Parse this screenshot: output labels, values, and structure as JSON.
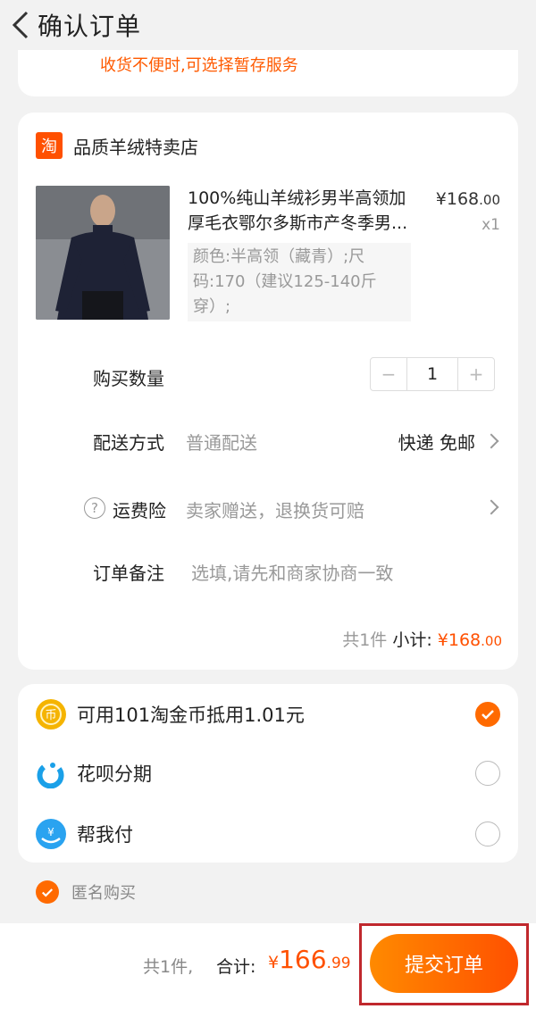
{
  "header": {
    "title": "确认订单",
    "back_icon": "chevron-left-icon"
  },
  "notice": {
    "text": "收货不便时,可选择暂存服务"
  },
  "shop": {
    "logo_text": "淘",
    "name": "品质羊绒特卖店"
  },
  "product": {
    "title": "100%纯山羊绒衫男半高领加厚毛衣鄂尔多斯市产冬季男...",
    "price_currency": "¥",
    "price_int": "168",
    "price_dec": ".00",
    "quantity": "x1",
    "spec": "颜色:半高领（藏青）;尺码:170（建议125-140斤穿）;"
  },
  "purchase_qty": {
    "label": "购买数量",
    "minus": "−",
    "value": "1",
    "plus": "+"
  },
  "delivery": {
    "label": "配送方式",
    "value": "普通配送",
    "right": "快递 免邮"
  },
  "insurance": {
    "label": "运费险",
    "value": "卖家赠送，退换货可赔"
  },
  "remark": {
    "label": "订单备注",
    "placeholder": "选填,请先和商家协商一致"
  },
  "subtotal": {
    "count": "共1件",
    "label": "小计:",
    "currency": "¥",
    "int": "168",
    "dec": ".00"
  },
  "payments": [
    {
      "label": "可用101淘金币抵用1.01元",
      "icon": "taojinbi-coin-icon",
      "checked": true
    },
    {
      "label": "花呗分期",
      "icon": "huabei-icon",
      "checked": false
    },
    {
      "label": "帮我付",
      "icon": "help-pay-icon",
      "checked": false
    }
  ],
  "anonymous": {
    "label": "匿名购买",
    "checked": true
  },
  "footer": {
    "count": "共1件,",
    "total_label": "合计:",
    "currency": "¥",
    "total_int": "166",
    "total_dec": ".99",
    "submit_label": "提交订单"
  },
  "colors": {
    "accent": "#ff5000",
    "highlight_frame": "#c0282d"
  }
}
